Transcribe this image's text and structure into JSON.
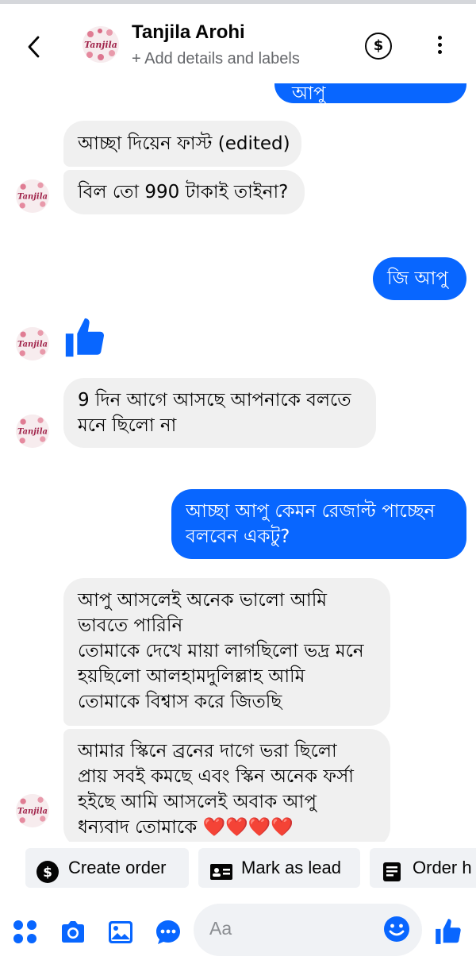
{
  "header": {
    "title": "Tanjila Arohi",
    "subtitle": "+ Add details and labels",
    "avatar_text": "Tanjila",
    "dollar_symbol": "$"
  },
  "messages": [
    {
      "side": "out",
      "text": "ও ই দিন আগে নিয়ে আপু",
      "partial": true
    },
    {
      "side": "in",
      "text": "আচ্ছা দিয়েন ফাস্ট (edited)"
    },
    {
      "side": "in",
      "text": "বিল তো 990 টাকাই তাইনা?"
    },
    {
      "side": "out",
      "text": "জি আপু"
    },
    {
      "side": "in",
      "type": "like"
    },
    {
      "side": "in",
      "text": "9 দিন আগে আসছে আপনাকে বলতে\nমনে ছিলো না"
    },
    {
      "side": "out",
      "text": "আচ্ছা আপু কেমন রেজাল্ট পাচ্ছেন\nবলবেন একটু?"
    },
    {
      "side": "in",
      "text": "আপু আসলেই অনেক ভালো আমি\nভাবতে পারিনি\nতোমাকে দেখে মায়া লাগছিলো ভদ্র মনে\nহয়ছিলো আলহামদুলিল্লাহ আমি\nতোমাকে বিশ্বাস করে জিতছি"
    },
    {
      "side": "in",
      "text": "আমার স্কিনে  ব্রনের দাগে ভরা ছিলো\nপ্রায় সবই কমছে এবং স্কিন অনেক ফর্সা\nহইছে আমি আসলেই অবাক আপু\nধন্যবাদ তোমাকে ❤️❤️❤️❤️"
    }
  ],
  "quick_replies": [
    "Create order",
    "Mark as lead",
    "Order h"
  ],
  "composer": {
    "placeholder": "Aa"
  },
  "colors": {
    "accent": "#0866ff",
    "incoming_bubble": "#f0f0f0",
    "muted": "#65676b"
  }
}
